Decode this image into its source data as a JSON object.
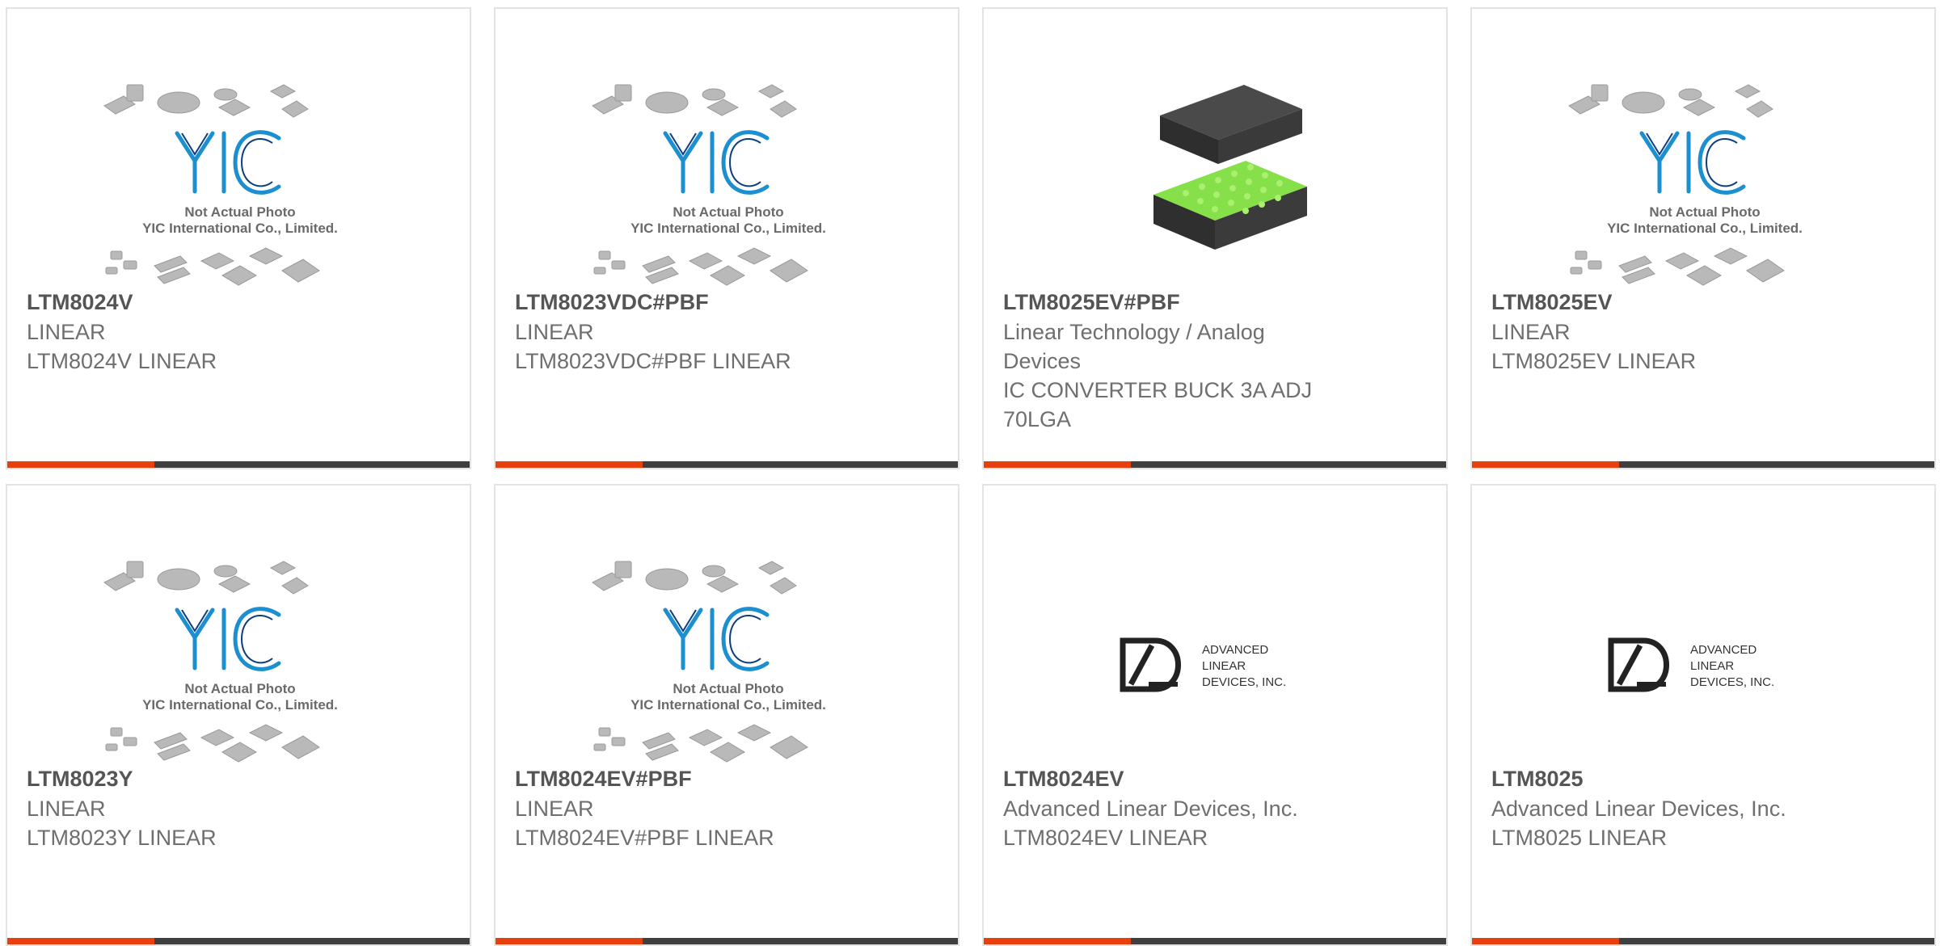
{
  "colors": {
    "accent": "#e8400c",
    "bar": "#3f3f3f",
    "border": "#e3e3e3",
    "part_number": "#555555",
    "text": "#6f6f6f",
    "yic_blue": "#1b8fd0"
  },
  "placeholder": {
    "line1": "Not Actual Photo",
    "line2": "YIC International Co., Limited.",
    "brand": "YIC"
  },
  "adl_logo": {
    "line1": "ADVANCED",
    "line2": "LINEAR",
    "line3": "DEVICES, INC."
  },
  "products": [
    {
      "part_number": "LTM8024V",
      "manufacturer": "LINEAR",
      "description": "LTM8024V LINEAR",
      "image": "yic-placeholder-image"
    },
    {
      "part_number": "LTM8023VDC#PBF",
      "manufacturer": "LINEAR",
      "description": "LTM8023VDC#PBF LINEAR",
      "image": "yic-placeholder-image"
    },
    {
      "part_number": "LTM8025EV#PBF",
      "manufacturer": "Linear Technology / Analog Devices",
      "description": "IC CONVERTER BUCK 3A ADJ 70LGA",
      "image": "lga-package-image"
    },
    {
      "part_number": "LTM8025EV",
      "manufacturer": "LINEAR",
      "description": "LTM8025EV LINEAR",
      "image": "yic-placeholder-image"
    },
    {
      "part_number": "LTM8023Y",
      "manufacturer": "LINEAR",
      "description": "LTM8023Y LINEAR",
      "image": "yic-placeholder-image"
    },
    {
      "part_number": "LTM8024EV#PBF",
      "manufacturer": "LINEAR",
      "description": "LTM8024EV#PBF LINEAR",
      "image": "yic-placeholder-image"
    },
    {
      "part_number": "LTM8024EV",
      "manufacturer": "Advanced Linear Devices, Inc.",
      "description": "LTM8024EV LINEAR",
      "image": "ald-logo-image"
    },
    {
      "part_number": "LTM8025",
      "manufacturer": "Advanced Linear Devices, Inc.",
      "description": "LTM8025 LINEAR",
      "image": "ald-logo-image"
    }
  ]
}
